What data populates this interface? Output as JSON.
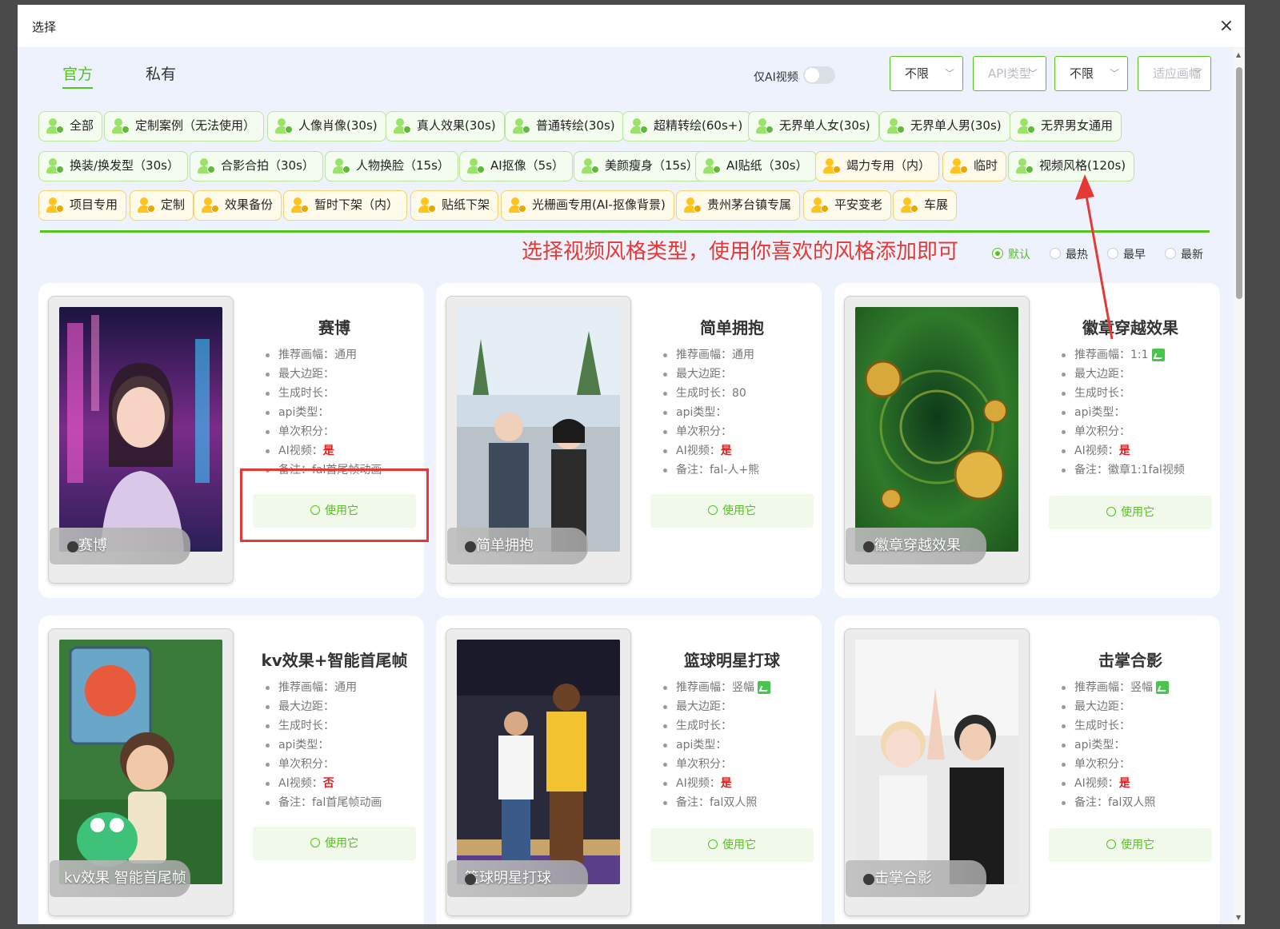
{
  "modal": {
    "title": "选择"
  },
  "tabs": [
    {
      "label": "官方",
      "active": true
    },
    {
      "label": "私有",
      "active": false
    }
  ],
  "toggle": {
    "label": "仅AI视频",
    "on": false
  },
  "filters": [
    {
      "value": "不限",
      "placeholder": false
    },
    {
      "value": "API类型",
      "placeholder": true
    },
    {
      "value": "不限",
      "placeholder": false
    },
    {
      "value": "适应画幅",
      "placeholder": true
    }
  ],
  "categories": [
    {
      "label": "全部",
      "color": "green"
    },
    {
      "label": "定制案例（无法使用）",
      "color": "green"
    },
    {
      "label": "人像肖像(30s)",
      "color": "green"
    },
    {
      "label": "真人效果(30s)",
      "color": "green"
    },
    {
      "label": "普通转绘(30s)",
      "color": "green"
    },
    {
      "label": "超精转绘(60s+)",
      "color": "green"
    },
    {
      "label": "无界单人女(30s)",
      "color": "green"
    },
    {
      "label": "无界单人男(30s)",
      "color": "green"
    },
    {
      "label": "无界男女通用",
      "color": "green"
    },
    {
      "label": "换装/换发型（30s）",
      "color": "green"
    },
    {
      "label": "合影合拍（30s）",
      "color": "green"
    },
    {
      "label": "人物换脸（15s）",
      "color": "green"
    },
    {
      "label": "AI抠像（5s）",
      "color": "green"
    },
    {
      "label": "美颜瘦身（15s）",
      "color": "green"
    },
    {
      "label": "AI贴纸（30s）",
      "color": "green"
    },
    {
      "label": "竭力专用（内）",
      "color": "yellow"
    },
    {
      "label": "临时",
      "color": "yellow"
    },
    {
      "label": "视频风格(120s)",
      "color": "green"
    },
    {
      "label": "项目专用",
      "color": "yellow"
    },
    {
      "label": "定制",
      "color": "yellow"
    },
    {
      "label": "效果备份",
      "color": "yellow"
    },
    {
      "label": "暂时下架（内）",
      "color": "yellow"
    },
    {
      "label": "贴纸下架",
      "color": "yellow"
    },
    {
      "label": "光栅画专用(AI-抠像背景)",
      "color": "yellow"
    },
    {
      "label": "贵州茅台镇专属",
      "color": "yellow"
    },
    {
      "label": "平安变老",
      "color": "yellow"
    },
    {
      "label": "车展",
      "color": "yellow"
    }
  ],
  "annotation": {
    "text": "选择视频风格类型，使用你喜欢的风格添加即可",
    "color": "#e53935"
  },
  "sort": {
    "options": [
      "默认",
      "最热",
      "最早",
      "最新"
    ],
    "selected": "默认"
  },
  "labels": {
    "ratio": "推荐画幅：",
    "margin": "最大边距：",
    "duration": "生成时长：",
    "api": "api类型：",
    "points": "单次积分：",
    "ai": "AI视频：",
    "note": "备注：",
    "use": "使用它"
  },
  "cards": [
    {
      "title": "赛博",
      "caption": "赛博",
      "ratio": "通用",
      "margin": "",
      "duration": "",
      "api": "",
      "points": "",
      "ai": "是",
      "note": "fal首尾帧动画",
      "ratio_icon": false,
      "image": "cyber-portrait"
    },
    {
      "title": "简单拥抱",
      "caption": "简单拥抱",
      "ratio": "通用",
      "margin": "",
      "duration": "80",
      "api": "",
      "points": "",
      "ai": "是",
      "note": "fal-人+熊",
      "ratio_icon": false,
      "image": "couple-hug"
    },
    {
      "title": "徽章穿越效果",
      "caption": "徽章穿越效果",
      "ratio": "1:1",
      "margin": "",
      "duration": "",
      "api": "",
      "points": "",
      "ai": "是",
      "note": "徽章1:1fal视频",
      "ratio_icon": true,
      "image": "pocket-watch-vortex"
    },
    {
      "title": "kv效果+智能首尾帧",
      "caption": "kv效果 智能首尾帧",
      "ratio": "通用",
      "margin": "",
      "duration": "",
      "api": "",
      "points": "",
      "ai": "否",
      "note": "fal首尾帧动画",
      "ratio_icon": false,
      "image": "cartoon-girl-frog"
    },
    {
      "title": "篮球明星打球",
      "caption": "篮球明星打球",
      "ratio": "竖幅",
      "margin": "",
      "duration": "",
      "api": "",
      "points": "",
      "ai": "是",
      "note": "fal双人照",
      "ratio_icon": true,
      "image": "basketball-star"
    },
    {
      "title": "击掌合影",
      "caption": "击掌合影",
      "ratio": "竖幅",
      "margin": "",
      "duration": "",
      "api": "",
      "points": "",
      "ai": "是",
      "note": "fal双人照",
      "ratio_icon": true,
      "image": "high-five"
    }
  ],
  "colors": {
    "accent": "#52c41a",
    "annotation": "#e53935",
    "bodyBg": "#edf2fc"
  }
}
